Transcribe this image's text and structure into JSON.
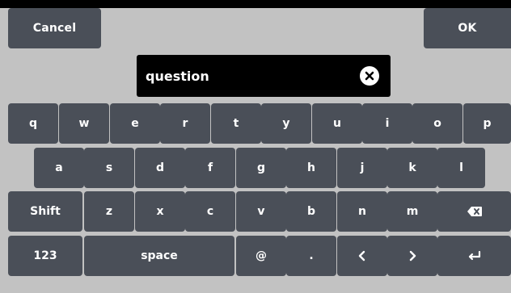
{
  "buttons": {
    "cancel": "Cancel",
    "ok": "OK"
  },
  "input": {
    "value": "question"
  },
  "keyboard": {
    "row1": [
      "q",
      "w",
      "e",
      "r",
      "t",
      "y",
      "u",
      "i",
      "o",
      "p"
    ],
    "row2": [
      "a",
      "s",
      "d",
      "f",
      "g",
      "h",
      "j",
      "k",
      "l"
    ],
    "row3": {
      "shift": "Shift",
      "keys": [
        "z",
        "x",
        "c",
        "v",
        "b",
        "n",
        "m"
      ],
      "backspace_icon": "backspace-icon"
    },
    "row4": {
      "numbers": "123",
      "space": "space",
      "at": "@",
      "dot": ".",
      "left_icon": "chevron-left-icon",
      "right_icon": "chevron-right-icon",
      "enter_icon": "enter-icon"
    }
  },
  "colors": {
    "key": "#4a4f58",
    "background": "#c2c2c2",
    "field": "#000000",
    "text": "#ffffff"
  }
}
